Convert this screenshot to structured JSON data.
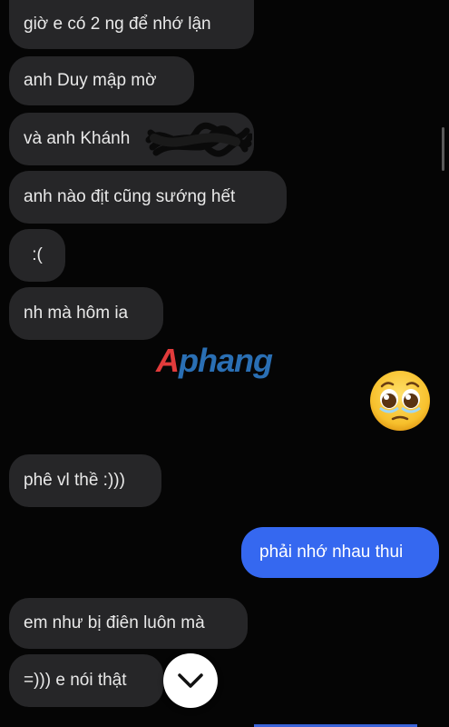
{
  "messages": [
    {
      "side": "in",
      "text": "giờ e có 2 ng để nhớ lận"
    },
    {
      "side": "in",
      "text": "anh Duy mập mờ"
    },
    {
      "side": "in",
      "text": "và anh Khánh"
    },
    {
      "side": "in",
      "text": "anh nào địt cũng sướng hết"
    },
    {
      "side": "in",
      "text": ":("
    },
    {
      "side": "in",
      "text": "nh mà hôm ia"
    },
    {
      "side": "in",
      "emoji": "pleading-face-emoji"
    },
    {
      "side": "in",
      "text": "phê vl thề :)))"
    },
    {
      "side": "out",
      "text": "phải nhớ nhau thui"
    },
    {
      "side": "in",
      "text": "em như bị điên luôn mà"
    },
    {
      "side": "in",
      "text": "=))) e nói thật"
    }
  ],
  "watermark": {
    "first": "A",
    "rest": "phang"
  },
  "scroll_button": {
    "icon": "chevron-down-icon"
  },
  "colors": {
    "incoming_bubble": "#262628",
    "outgoing_bubble": "#3568f0",
    "background": "#050505"
  }
}
